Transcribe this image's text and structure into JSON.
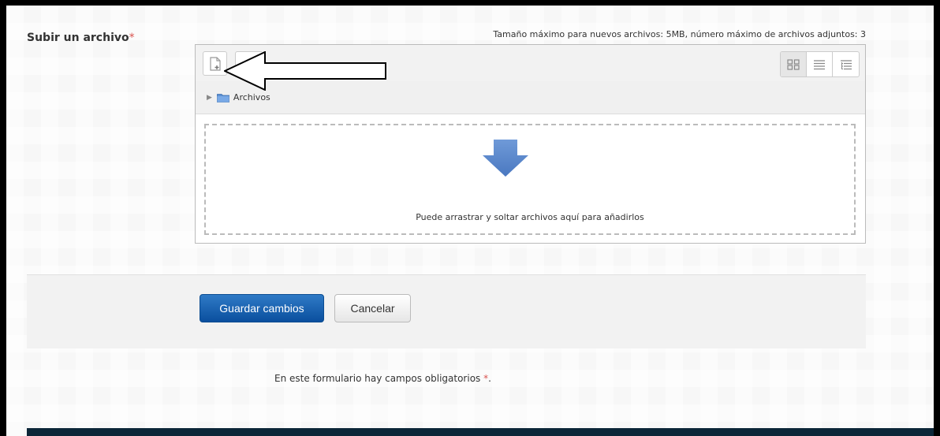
{
  "form": {
    "field_label": "Subir un archivo",
    "required_marker": "*",
    "limits_text": "Tamaño máximo para nuevos archivos: 5MB, número máximo de archivos adjuntos: 3"
  },
  "filemanager": {
    "toolbar": {
      "add_icon": "add-file-icon",
      "view_icons": [
        "grid-view-icon",
        "list-view-icon",
        "tree-view-icon"
      ],
      "active_view": "grid"
    },
    "path": {
      "folder_name": "Archivos",
      "folder_icon": "folder-icon"
    },
    "dropzone": {
      "icon": "down-arrow-icon",
      "text": "Puede arrastrar y soltar archivos aquí para añadirlos"
    }
  },
  "buttons": {
    "save_label": "Guardar cambios",
    "cancel_label": "Cancelar"
  },
  "required_note": {
    "text": "En este formulario hay campos obligatorios ",
    "marker": "*",
    "suffix": "."
  },
  "colors": {
    "accent": "#0a4f9e",
    "required": "#d9534f",
    "footer": "#0c2638"
  }
}
